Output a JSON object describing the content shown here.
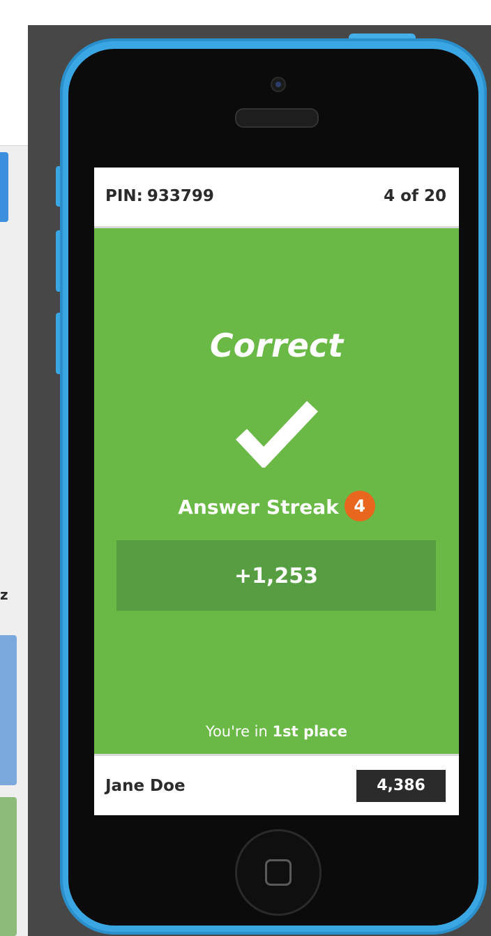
{
  "left_panel": {
    "truncated_label": "z"
  },
  "game": {
    "pin_label": "PIN:",
    "pin_value": "933799",
    "question_counter": "4 of 20",
    "result_title": "Correct",
    "result_icon": "checkmark-icon",
    "streak_label": "Answer Streak",
    "streak_count": "4",
    "points_earned": "+1,253",
    "rank_prefix": "You're in",
    "rank_place": "1st place",
    "player_name": "Jane Doe",
    "total_score": "4,386"
  },
  "colors": {
    "correct_green": "#6ab846",
    "points_box_green": "#579e42",
    "streak_orange": "#e8661e",
    "phone_frame_blue": "#3aa6e3",
    "score_box_dark": "#2b2b2b"
  }
}
